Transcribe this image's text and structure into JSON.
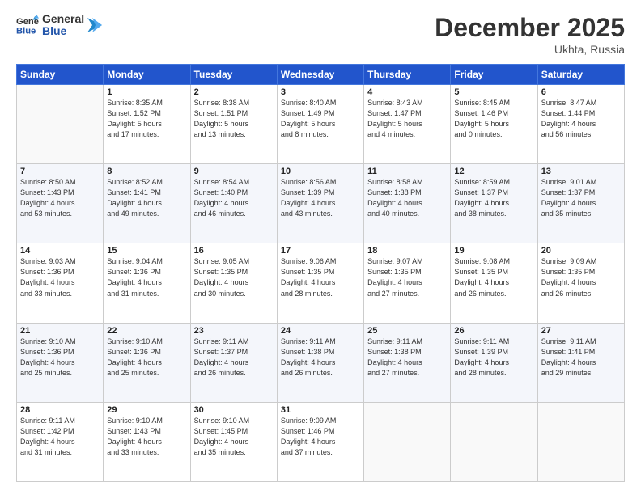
{
  "header": {
    "logo_line1": "General",
    "logo_line2": "Blue",
    "month": "December 2025",
    "location": "Ukhta, Russia"
  },
  "days_of_week": [
    "Sunday",
    "Monday",
    "Tuesday",
    "Wednesday",
    "Thursday",
    "Friday",
    "Saturday"
  ],
  "weeks": [
    [
      {
        "day": "",
        "info": ""
      },
      {
        "day": "1",
        "info": "Sunrise: 8:35 AM\nSunset: 1:52 PM\nDaylight: 5 hours\nand 17 minutes."
      },
      {
        "day": "2",
        "info": "Sunrise: 8:38 AM\nSunset: 1:51 PM\nDaylight: 5 hours\nand 13 minutes."
      },
      {
        "day": "3",
        "info": "Sunrise: 8:40 AM\nSunset: 1:49 PM\nDaylight: 5 hours\nand 8 minutes."
      },
      {
        "day": "4",
        "info": "Sunrise: 8:43 AM\nSunset: 1:47 PM\nDaylight: 5 hours\nand 4 minutes."
      },
      {
        "day": "5",
        "info": "Sunrise: 8:45 AM\nSunset: 1:46 PM\nDaylight: 5 hours\nand 0 minutes."
      },
      {
        "day": "6",
        "info": "Sunrise: 8:47 AM\nSunset: 1:44 PM\nDaylight: 4 hours\nand 56 minutes."
      }
    ],
    [
      {
        "day": "7",
        "info": "Sunrise: 8:50 AM\nSunset: 1:43 PM\nDaylight: 4 hours\nand 53 minutes."
      },
      {
        "day": "8",
        "info": "Sunrise: 8:52 AM\nSunset: 1:41 PM\nDaylight: 4 hours\nand 49 minutes."
      },
      {
        "day": "9",
        "info": "Sunrise: 8:54 AM\nSunset: 1:40 PM\nDaylight: 4 hours\nand 46 minutes."
      },
      {
        "day": "10",
        "info": "Sunrise: 8:56 AM\nSunset: 1:39 PM\nDaylight: 4 hours\nand 43 minutes."
      },
      {
        "day": "11",
        "info": "Sunrise: 8:58 AM\nSunset: 1:38 PM\nDaylight: 4 hours\nand 40 minutes."
      },
      {
        "day": "12",
        "info": "Sunrise: 8:59 AM\nSunset: 1:37 PM\nDaylight: 4 hours\nand 38 minutes."
      },
      {
        "day": "13",
        "info": "Sunrise: 9:01 AM\nSunset: 1:37 PM\nDaylight: 4 hours\nand 35 minutes."
      }
    ],
    [
      {
        "day": "14",
        "info": "Sunrise: 9:03 AM\nSunset: 1:36 PM\nDaylight: 4 hours\nand 33 minutes."
      },
      {
        "day": "15",
        "info": "Sunrise: 9:04 AM\nSunset: 1:36 PM\nDaylight: 4 hours\nand 31 minutes."
      },
      {
        "day": "16",
        "info": "Sunrise: 9:05 AM\nSunset: 1:35 PM\nDaylight: 4 hours\nand 30 minutes."
      },
      {
        "day": "17",
        "info": "Sunrise: 9:06 AM\nSunset: 1:35 PM\nDaylight: 4 hours\nand 28 minutes."
      },
      {
        "day": "18",
        "info": "Sunrise: 9:07 AM\nSunset: 1:35 PM\nDaylight: 4 hours\nand 27 minutes."
      },
      {
        "day": "19",
        "info": "Sunrise: 9:08 AM\nSunset: 1:35 PM\nDaylight: 4 hours\nand 26 minutes."
      },
      {
        "day": "20",
        "info": "Sunrise: 9:09 AM\nSunset: 1:35 PM\nDaylight: 4 hours\nand 26 minutes."
      }
    ],
    [
      {
        "day": "21",
        "info": "Sunrise: 9:10 AM\nSunset: 1:36 PM\nDaylight: 4 hours\nand 25 minutes."
      },
      {
        "day": "22",
        "info": "Sunrise: 9:10 AM\nSunset: 1:36 PM\nDaylight: 4 hours\nand 25 minutes."
      },
      {
        "day": "23",
        "info": "Sunrise: 9:11 AM\nSunset: 1:37 PM\nDaylight: 4 hours\nand 26 minutes."
      },
      {
        "day": "24",
        "info": "Sunrise: 9:11 AM\nSunset: 1:38 PM\nDaylight: 4 hours\nand 26 minutes."
      },
      {
        "day": "25",
        "info": "Sunrise: 9:11 AM\nSunset: 1:38 PM\nDaylight: 4 hours\nand 27 minutes."
      },
      {
        "day": "26",
        "info": "Sunrise: 9:11 AM\nSunset: 1:39 PM\nDaylight: 4 hours\nand 28 minutes."
      },
      {
        "day": "27",
        "info": "Sunrise: 9:11 AM\nSunset: 1:41 PM\nDaylight: 4 hours\nand 29 minutes."
      }
    ],
    [
      {
        "day": "28",
        "info": "Sunrise: 9:11 AM\nSunset: 1:42 PM\nDaylight: 4 hours\nand 31 minutes."
      },
      {
        "day": "29",
        "info": "Sunrise: 9:10 AM\nSunset: 1:43 PM\nDaylight: 4 hours\nand 33 minutes."
      },
      {
        "day": "30",
        "info": "Sunrise: 9:10 AM\nSunset: 1:45 PM\nDaylight: 4 hours\nand 35 minutes."
      },
      {
        "day": "31",
        "info": "Sunrise: 9:09 AM\nSunset: 1:46 PM\nDaylight: 4 hours\nand 37 minutes."
      },
      {
        "day": "",
        "info": ""
      },
      {
        "day": "",
        "info": ""
      },
      {
        "day": "",
        "info": ""
      }
    ]
  ]
}
